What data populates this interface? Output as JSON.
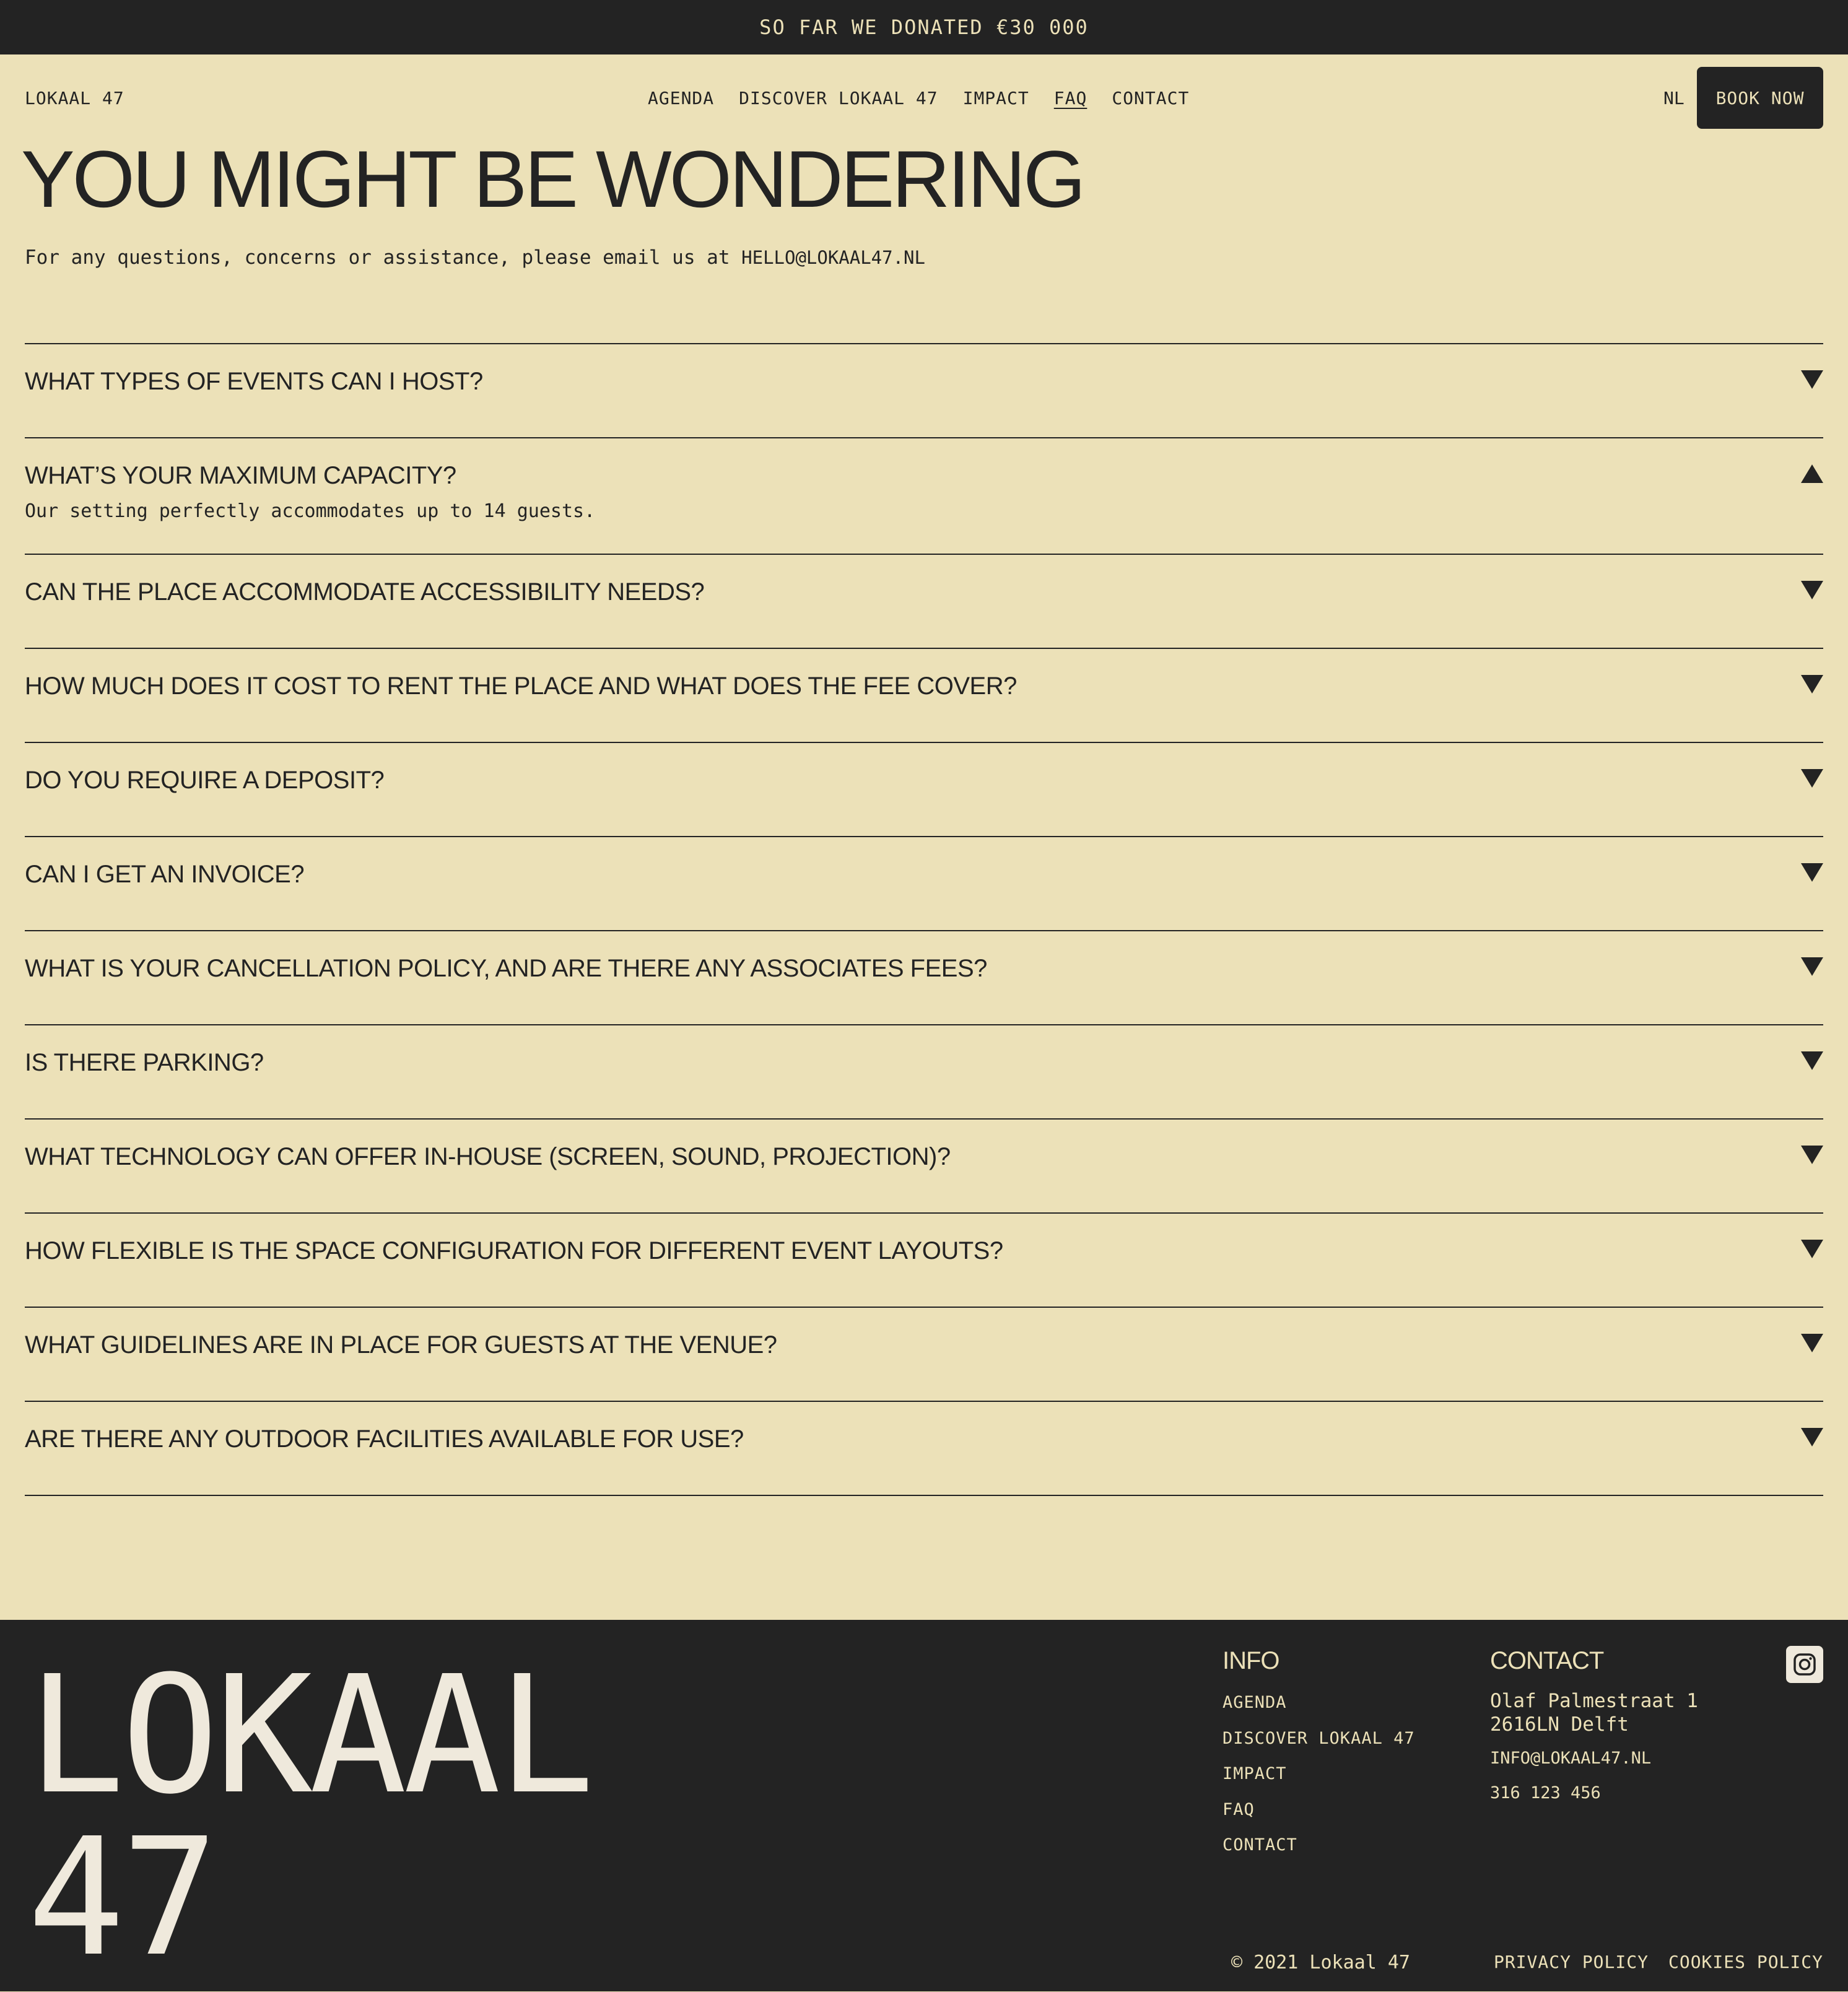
{
  "banner": {
    "text": "SO FAR WE DONATED €30 000"
  },
  "header": {
    "logo": "LOKAAL 47",
    "nav": [
      "AGENDA",
      "DISCOVER LOKAAL 47",
      "IMPACT",
      "FAQ",
      "CONTACT"
    ],
    "active_nav": "FAQ",
    "lang": "NL",
    "book_label": "BOOK NOW"
  },
  "hero": {
    "title": "YOU MIGHT BE WONDERING",
    "subtitle": "For any questions, concerns or assistance, please email us at ",
    "email": "HELLO@LOKAAL47.NL"
  },
  "faq": {
    "items": [
      {
        "q": "WHAT TYPES OF EVENTS CAN I HOST?",
        "expanded": false
      },
      {
        "q": "WHAT’S YOUR MAXIMUM CAPACITY?",
        "expanded": true,
        "a": "Our setting perfectly accommodates up to 14 guests."
      },
      {
        "q": "CAN THE PLACE ACCOMMODATE ACCESSIBILITY NEEDS?",
        "expanded": false
      },
      {
        "q": "HOW MUCH DOES IT COST TO RENT THE PLACE AND WHAT DOES THE FEE COVER?",
        "expanded": false
      },
      {
        "q": "DO YOU REQUIRE A DEPOSIT?",
        "expanded": false
      },
      {
        "q": "CAN I GET AN INVOICE?",
        "expanded": false
      },
      {
        "q": "WHAT IS YOUR CANCELLATION POLICY, AND ARE THERE ANY ASSOCIATES FEES?",
        "expanded": false
      },
      {
        "q": "IS THERE PARKING?",
        "expanded": false
      },
      {
        "q": "WHAT TECHNOLOGY CAN OFFER IN-HOUSE (SCREEN, SOUND, PROJECTION)?",
        "expanded": false
      },
      {
        "q": "HOW FLEXIBLE IS THE SPACE CONFIGURATION FOR DIFFERENT EVENT LAYOUTS?",
        "expanded": false
      },
      {
        "q": "WHAT GUIDELINES ARE IN PLACE FOR GUESTS AT THE VENUE?",
        "expanded": false
      },
      {
        "q": "ARE THERE ANY OUTDOOR FACILITIES AVAILABLE FOR USE?",
        "expanded": false
      }
    ]
  },
  "footer": {
    "logo_line1": "LOKAAL",
    "logo_line2": "47",
    "info_title": "INFO",
    "info_links": [
      "AGENDA",
      "DISCOVER LOKAAL 47",
      "IMPACT",
      "FAQ",
      "CONTACT"
    ],
    "contact_title": "CONTACT",
    "address_line1": "Olaf Palmestraat 1",
    "address_line2": "2616LN Delft",
    "email": "INFO@LOKAAL47.NL",
    "phone": "316 123 456",
    "social_icon": "instagram-icon",
    "copyright": "© 2021 Lokaal 47",
    "privacy": "PRIVACY POLICY",
    "cookies": "COOKIES POLICY"
  },
  "colors": {
    "background": "#ece1b8",
    "dark": "#232323",
    "light_text": "#efe9dc"
  }
}
